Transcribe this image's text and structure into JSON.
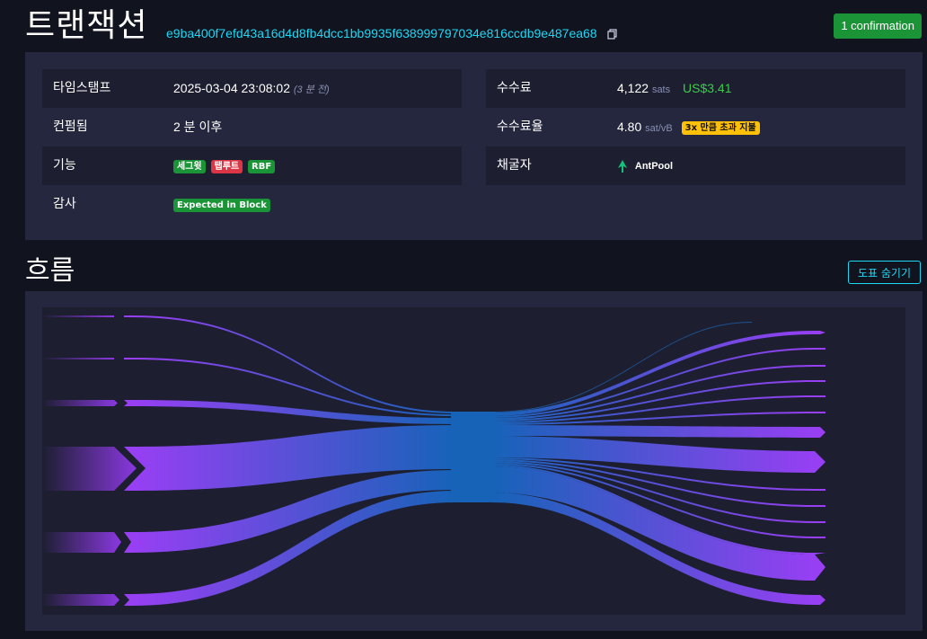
{
  "header": {
    "title": "트랜잭션",
    "txid": "e9ba400f7efd43a16d4d8fb4dcc1bb9935f638999797034e816ccdb9e487ea68",
    "confirmations": "1 confirmation"
  },
  "details": {
    "left": {
      "timestamp": {
        "label": "타임스탬프",
        "value": "2025-03-04 23:08:02",
        "ago": "(3 분 전)"
      },
      "confirmed": {
        "label": "컨펌됨",
        "value": "2 분 이후"
      },
      "features": {
        "label": "기능",
        "tags": [
          "세그윗",
          "탭루트",
          "RBF"
        ]
      },
      "audit": {
        "label": "감사",
        "badge": "Expected in Block"
      }
    },
    "right": {
      "fee": {
        "label": "수수료",
        "value": "4,122",
        "unit": "sats",
        "usd": "US$3.41"
      },
      "fee_rate": {
        "label": "수수료율",
        "value": "4.80",
        "unit": "sat/vB",
        "badge": "3x 만큼 초과 지불"
      },
      "miner": {
        "label": "채굴자",
        "name": "AntPool"
      }
    }
  },
  "flow": {
    "title": "흐름",
    "hide_button": "도표 숨기기"
  },
  "colors": {
    "accent": "#1bd8f4",
    "success": "#1a9436",
    "danger": "#dc3545",
    "warning": "#ffc107",
    "usd": "#3bcc49",
    "flow_purple": "#9b3ef5",
    "flow_blue": "#1663b8"
  }
}
